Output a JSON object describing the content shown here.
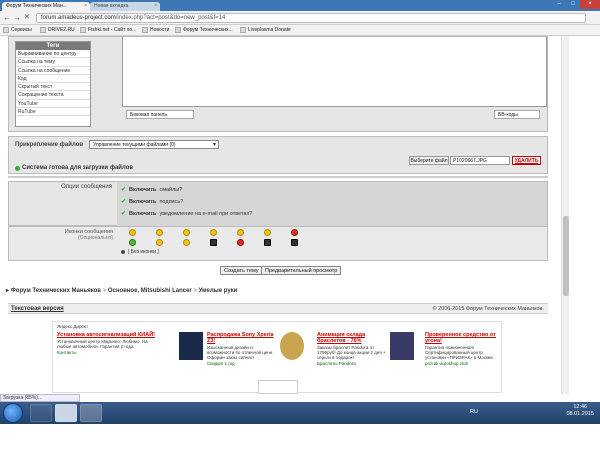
{
  "browser": {
    "tabs": [
      {
        "label": "Форум Технических Ман...",
        "active": true
      },
      {
        "label": "Новая вкладка",
        "active": false
      }
    ],
    "url_host": "forum.amadeus-project.com",
    "url_path": "/index.php?act=post&do=new_post&f=14",
    "bookmarks": [
      "Сервисы",
      "DRIVE2.RU",
      "Fishki.net - Сайт хо...",
      "Новости",
      "Форум Технических...",
      "Liveplasma Donate"
    ]
  },
  "tags": {
    "header": "Теги",
    "items": [
      "Выравнивание по центру",
      "Ссылка на тему",
      "Ссылка на сообщение",
      "Код",
      "Скрытый текст",
      "Сокращение текста",
      "YouTube",
      "RuTube"
    ]
  },
  "editor": {
    "side_panel_label": "Боковая панель",
    "bbcode_label": "BB-коды"
  },
  "attachments": {
    "label": "Прикрепление файлов",
    "select_value": "Управление текущими файлами (0)",
    "choose_file_label": "Выберите файл",
    "file_name": "P1020667.JPG",
    "delete_label": "УДАЛИТЬ",
    "status": "Система готова для загрузки файлов"
  },
  "options": {
    "label": "Опции сообщения",
    "items": [
      {
        "bold": "Включить",
        "rest": "смайлы?"
      },
      {
        "bold": "Включить",
        "rest": "подпись?"
      },
      {
        "bold": "Включить",
        "rest": "уведомление на e-mail при ответах?"
      }
    ]
  },
  "smilies": {
    "label": "Иконки сообщения",
    "sublabel": "(Опционально)",
    "none_label": "[ Без иконки ]"
  },
  "actions": {
    "submit": "Создать тему",
    "preview": "Предварительный просмотр"
  },
  "breadcrumb": [
    "Форум Технических Маньяков",
    "Основное, Mitsubishi Lancer",
    "Умелые руки"
  ],
  "footer": {
    "text_version": "Текстовая версия",
    "copyright": "© 2006-2015 Форум Технических Маньяков."
  },
  "ads": {
    "label": "Яндекс.Директ",
    "items": [
      {
        "title": "Установка автосигнализаций КИАЙ!",
        "text": "Установочный центр Марьино. Любимо. На любые автомобили. Гарантия 2 года.",
        "link": "Контакты"
      },
      {
        "title": "Распродажа Sony Xperia Z3!",
        "text": "Изысканный дизайн и возможности по отличной цене. Оформи заказ сейчас!",
        "link": "Скидки! 1 год"
      },
      {
        "title": "Анимация склада браслетов - 76%",
        "text": "Заказы браслет Pandora от 1799руб! До конца акции 2 дня + серьги в подарок!",
        "link": "Браслеты Pandora"
      },
      {
        "title": "Проверенное средство от угона!",
        "text": "Гарантия пожизненная! Сертифицированный центр установки «ПРИЗРАК» в Москве.",
        "link": "prizrak-autoshop.club"
      }
    ]
  },
  "status_bar": "Загрузка (85%)...",
  "taskbar": {
    "language": "RU",
    "time": "12:46",
    "date": "08.01.2015"
  },
  "colors": {
    "titlebar": "#3d77b5",
    "panel": "#e6e6e6",
    "ad_title": "#c00000"
  }
}
